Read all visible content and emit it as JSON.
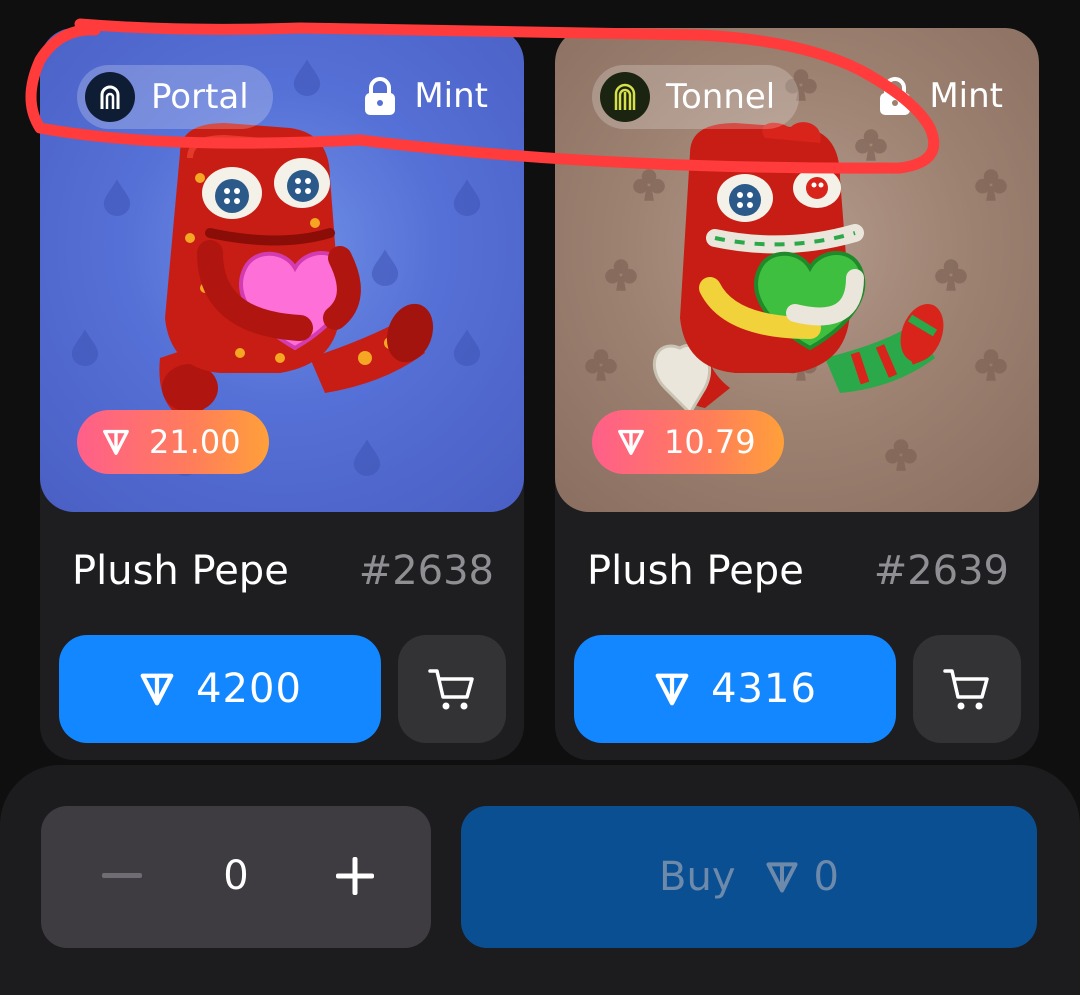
{
  "cards": [
    {
      "marketplace": "Portal",
      "mint_label": "Mint",
      "floor_price": "21.00",
      "name": "Plush Pepe",
      "number": "#2638",
      "price": "4200",
      "icons": {
        "marketplace": "portal-logo-icon",
        "mint": "lock-icon",
        "currency": "ton-icon",
        "cart": "cart-icon"
      },
      "colors": {
        "background": "#5570d6",
        "heart": "#ff6fd8"
      }
    },
    {
      "marketplace": "Tonnel",
      "mint_label": "Mint",
      "floor_price": "10.79",
      "name": "Plush Pepe",
      "number": "#2639",
      "price": "4316",
      "icons": {
        "marketplace": "tonnel-logo-icon",
        "mint": "lock-icon",
        "currency": "ton-icon",
        "cart": "cart-icon"
      },
      "colors": {
        "background": "#9c8070",
        "heart": "#3fbf3f"
      }
    }
  ],
  "bottom_bar": {
    "quantity": "0",
    "buy_label": "Buy",
    "total": "0",
    "icons": {
      "decrement": "minus-icon",
      "increment": "plus-icon",
      "currency": "ton-icon"
    }
  },
  "colors": {
    "primary_button": "#1287ff",
    "checkout_button": "#0b4f93",
    "annotation": "#ff3b3b"
  }
}
